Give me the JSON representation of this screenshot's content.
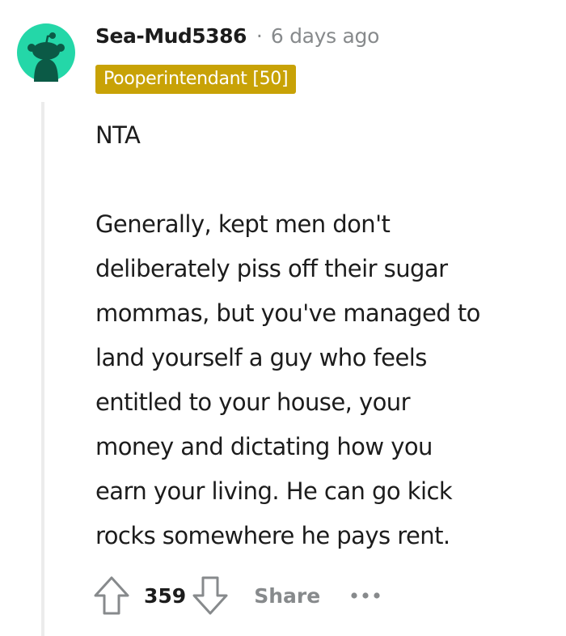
{
  "comment": {
    "username": "Sea-Mud5386",
    "separator": "·",
    "timestamp": "6 days ago",
    "flair": "Pooperintendant [50]",
    "paragraphs": [
      "NTA",
      "Generally, kept men don't\ndeliberately piss off their sugar\nmommas, but you've managed to\nland yourself a guy who feels\nentitled to your house, your\nmoney and dictating how you\nearn your living. He can go kick\nrocks somewhere he pays rent."
    ],
    "score": "359",
    "share_label": "Share"
  },
  "icons": {
    "avatar": "snoo-avatar-icon",
    "upvote": "upvote-arrow-icon",
    "downvote": "downvote-arrow-icon",
    "more": "more-options-icon"
  },
  "colors": {
    "avatar_bg": "#24d7a8",
    "flair_bg": "#c8a206",
    "muted_text": "#878a8c",
    "thread_line": "#ececec"
  }
}
